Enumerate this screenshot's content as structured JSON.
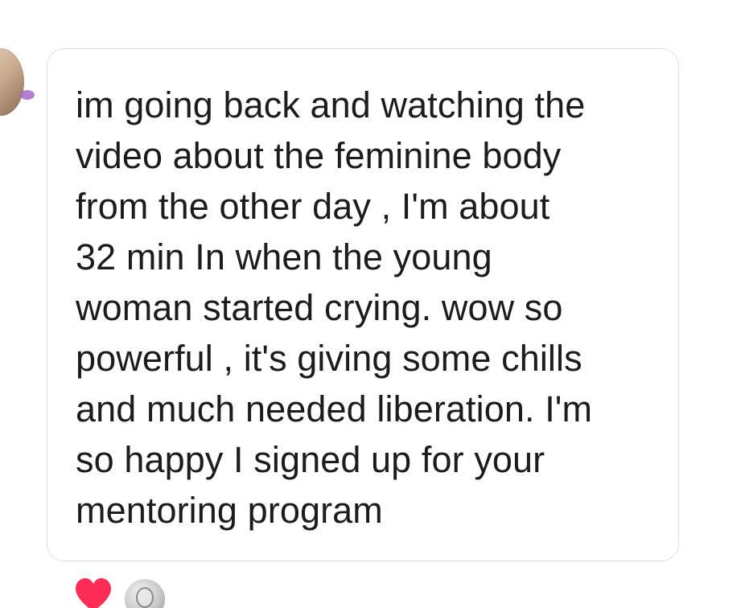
{
  "message": {
    "lines": [
      "im going back and watching the",
      "video about the feminine body",
      "from the other day , I'm about",
      "32 min In when the young",
      "woman started crying. wow so",
      "powerful , it's giving some chills",
      "and much needed liberation. I'm",
      "so happy I signed up for your",
      "mentoring program"
    ]
  },
  "reactions": {
    "heart_color": "#ff2d55"
  },
  "colors": {
    "bubble_border": "#dedede",
    "text": "#1c1c1c",
    "background": "#ffffff"
  },
  "icons": {
    "reaction": "heart-icon",
    "sender": "avatar",
    "reactor": "reactor-avatar"
  }
}
